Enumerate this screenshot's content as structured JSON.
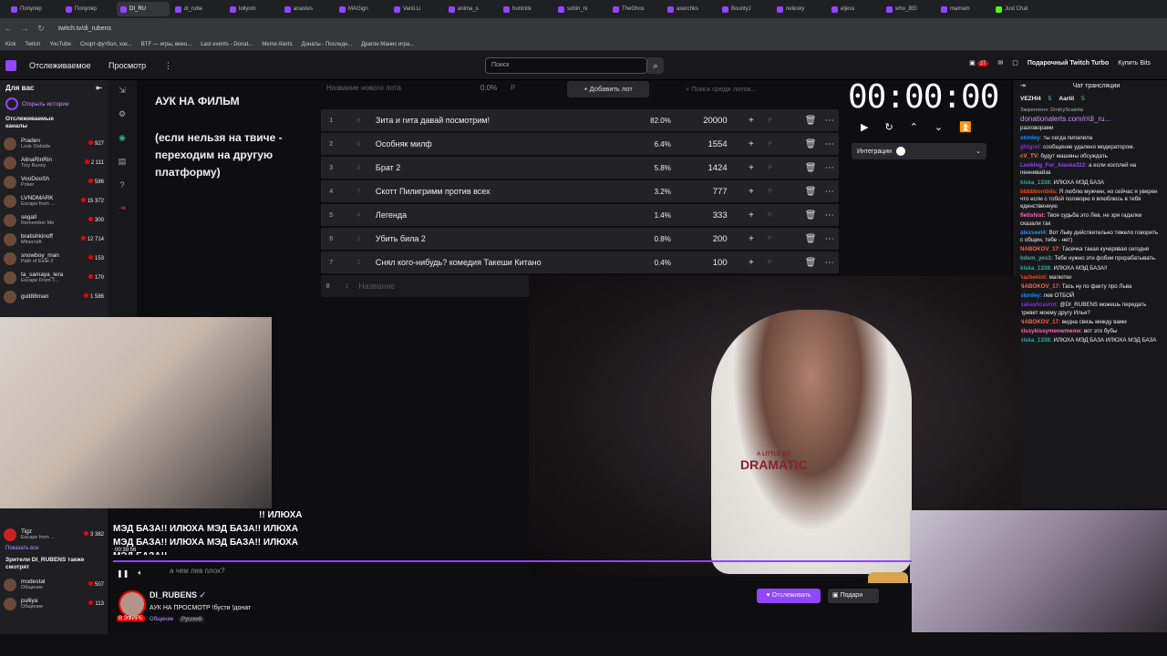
{
  "browser": {
    "tabs": [
      "Популяр",
      "Популяр",
      "DI_RU",
      "di_rube",
      "lollyom",
      "anastes",
      "MAGign",
      "Vanil.Li",
      "anima_s",
      "huntrick",
      "sobin_ni",
      "TheGhos",
      "aserchks",
      "BountyJ",
      "nelesky",
      "eljess",
      "who_BEl",
      "mamam",
      "Just Chat"
    ],
    "active_tab": 2,
    "url": "twitch.tv/di_rubens",
    "bookmarks": [
      "Kick",
      "Twitch",
      "YouTube",
      "Спорт-футбол, хок...",
      "BTF — игры, виео...",
      "Last events - Donat...",
      "Meme Alerts",
      "Донаты - Последн...",
      "Драгон Манис игра..."
    ]
  },
  "twitch_nav": {
    "following": "Отслеживаемое",
    "browse": "Просмотр",
    "search_placeholder": "Поиск",
    "notif_count": "27",
    "turbo": "Подарочный Twitch Turbo",
    "bits": "Купить Bits"
  },
  "sidebar": {
    "for_you": "Для вас",
    "open_stories": "Открыть истории",
    "followed": "Отслеживаемые каналы",
    "channels": [
      {
        "name": "Praden",
        "game": "Look Outside",
        "viewers": "927"
      },
      {
        "name": "AlinaRinRin",
        "game": "Tiny Bunny",
        "viewers": "2 111"
      },
      {
        "name": "VooDooSh",
        "game": "Poker",
        "viewers": "586"
      },
      {
        "name": "LVNDMARK",
        "game": "Escape from ...",
        "viewers": "15 372"
      },
      {
        "name": "segall",
        "game": "Remember Me",
        "viewers": "300"
      },
      {
        "name": "bratishkinoff",
        "game": "Minecraft",
        "viewers": "12 714"
      },
      {
        "name": "snowboy_man",
        "game": "Path of Exile 2",
        "viewers": "153"
      },
      {
        "name": "ta_samaya_lera",
        "game": "Escape From T...",
        "viewers": "170"
      },
      {
        "name": "guit88man",
        "game": "",
        "viewers": "1 586"
      }
    ],
    "bottom_channel": {
      "name": "Tigz",
      "game": "Escape from ...",
      "viewers": "3 382"
    },
    "show_all": "Показать все",
    "viewers_also": "Зрители DI_RUBENS также смотрят",
    "also_channels": [
      {
        "name": "modestal",
        "game": "Общение",
        "viewers": "507"
      },
      {
        "name": "pulliya",
        "game": "Общение",
        "viewers": "113"
      }
    ]
  },
  "auction": {
    "title": "АУК НА ФИЛЬМ",
    "note": "(если нельзя на твиче - переходим на другую платформу)",
    "new_lot_placeholder": "Название нового лота",
    "new_lot_pct": "0.0%",
    "new_lot_p": "Р",
    "add_lot": "Добавить лот",
    "lot_search": "Поиск среди лотов...",
    "rows": [
      {
        "n": "1",
        "g": "8",
        "title": "Зита и гита давай посмотрим!",
        "pct": "82.0%",
        "amount": "20000"
      },
      {
        "n": "2",
        "g": "6",
        "title": "Особняк милф",
        "pct": "6.4%",
        "amount": "1554"
      },
      {
        "n": "3",
        "g": "3",
        "title": "Брат 2",
        "pct": "5.8%",
        "amount": "1424"
      },
      {
        "n": "4",
        "g": "7",
        "title": "Скотт Пилигримм против всех",
        "pct": "3.2%",
        "amount": "777"
      },
      {
        "n": "5",
        "g": "4",
        "title": "Легенда",
        "pct": "1.4%",
        "amount": "333"
      },
      {
        "n": "6",
        "g": "2",
        "title": "Убить била 2",
        "pct": "0.8%",
        "amount": "200"
      },
      {
        "n": "7",
        "g": "2",
        "title": "Снял кого-нибудь? комедия Такеши Китано",
        "pct": "0.4%",
        "amount": "100"
      }
    ],
    "empty_row": {
      "n": "8",
      "g": "1",
      "title": "Название"
    },
    "timer": "00:00:00",
    "integrations": "Интеграции"
  },
  "chat": {
    "header": "Чат трансляции",
    "top_users": [
      "VEZHI4",
      "5",
      "Aartil",
      "5"
    ],
    "pinned": "Закреплено: DmitrySсaletta",
    "link": "donationalerts.com/r/di_ru...",
    "messages": [
      {
        "user": "",
        "text": "разговорами"
      },
      {
        "user": "stonley:",
        "text": " ты сегда пипапила"
      },
      {
        "user": "gfdgret:",
        "text": " сообщение удалено модератором."
      },
      {
        "user": "cV_TV:",
        "text": " будут машины обсуждать"
      },
      {
        "user": "Looking_For_Alaska322:",
        "text": " а если косплей на пеннивайза"
      },
      {
        "user": "kiska_1338:",
        "text": " ИЛЮХА МЭД БАЗА"
      },
      {
        "user": "bbbbbombila:",
        "text": " Я люблю мужчин, но сейчас я уверен что если с тобой поговорю я влюблюсь в тебя единственную"
      },
      {
        "user": "fletishist:",
        "text": " Твоя судьба это Лев, не зря гадалки сказали так"
      },
      {
        "user": "alexseet4:",
        "text": " Вот Льву действительно тяжело говорить с общин, тебе - нет)"
      },
      {
        "user": "NABOKOV_17:",
        "text": " Тасечка такая кучерявая сегодня"
      },
      {
        "user": "bdem_yes3:",
        "text": " Тебе нужно эти фобии прорабатывать."
      },
      {
        "user": "kiska_1338:",
        "text": " ИЛЮХА МЭД БАЗА!!"
      },
      {
        "user": "kazbekini:",
        "text": " малютки"
      },
      {
        "user": "NABOKOV_17:",
        "text": " Тась ну по факту про Льва"
      },
      {
        "user": "stonley:",
        "text": " лев ОТБОЙ"
      },
      {
        "user": "kakashcavrot:",
        "text": " @DI_RUBENS можешь передать привет моему другу Илье?"
      },
      {
        "user": "NABOKOV_17:",
        "text": " видна связь между вами"
      },
      {
        "user": "kissykissymeowmeow:",
        "text": " вот это бубы"
      },
      {
        "user": "kiska_1338:",
        "text": " ИЛЮХА МЭД БАЗА ИЛЮХА МЭД БАЗА"
      }
    ]
  },
  "player": {
    "caption": "!! ИЛЮХА МЭД БАЗА!! ИЛЮХА МЭД БАЗА!! ИЛЮХА МЭД БАЗА!! ИЛЮХА МЭД БАЗА!! ИЛЮХА МЭД БАЗА!!",
    "caption_lines": [
      "!! ИЛЮХА",
      "МЭД БАЗА!! ИЛЮХА МЭД БАЗА!! ИЛЮХА",
      "МЭД БАЗА!! ИЛЮХА МЭД БАЗА!! ИЛЮХА",
      "МЭД БАЗА!!"
    ],
    "timecode": "00:39:56",
    "chat_overlay": "а чем лев плох?",
    "shirt_top": "A LITTLE BIT",
    "shirt_main": "DRAMATIC"
  },
  "channel": {
    "name": "DI_RUBENS",
    "title": "АУК НА ПРОСМОТР !бусти !донат",
    "live": "В ЭФИРЕ",
    "category": "Общение",
    "language": "Русский",
    "follow": "Отслеживать",
    "subscribe": "Подари"
  },
  "colors": {
    "accent": "#9146ff",
    "live": "#eb0400"
  }
}
